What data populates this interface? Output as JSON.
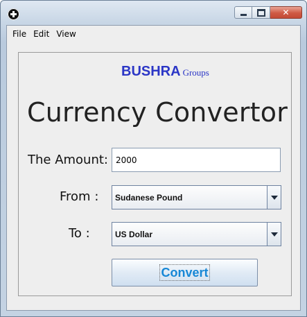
{
  "window": {
    "icon": "java-app-icon"
  },
  "menu": {
    "file": "File",
    "edit": "Edit",
    "view": "View"
  },
  "brand": {
    "main": "BUSHRA",
    "sub": "Groups"
  },
  "heading": "Currency Convertor",
  "form": {
    "amount_label": "The Amount:",
    "amount_value": "2000",
    "from_label": "From  :",
    "from_value": "Sudanese Pound",
    "to_label": "To   :",
    "to_value": "US Dollar",
    "convert_label": "Convert"
  },
  "colors": {
    "brand": "#2b36c6",
    "button_text": "#1687d6",
    "close_button": "#cf5a44"
  }
}
